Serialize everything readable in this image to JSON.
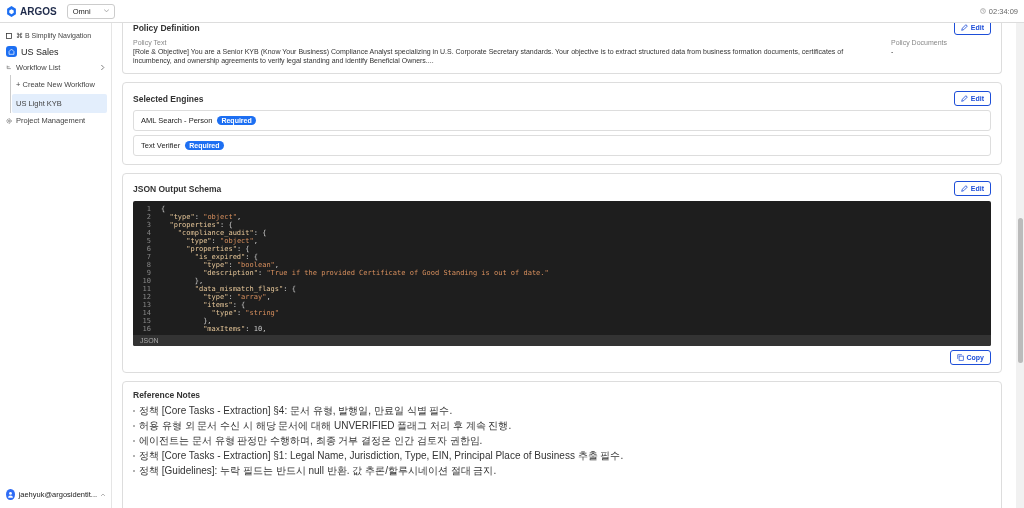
{
  "header": {
    "logo": "ARGOS",
    "workspace_select": {
      "value": "Omni"
    },
    "timer": "02:34:09"
  },
  "sidebar": {
    "shortcut": "⌘ B Simplify Navigation",
    "project": "US Sales",
    "items": [
      {
        "label": "Workflow List",
        "children": [
          {
            "label": "+ Create New Workflow",
            "selected": false
          },
          {
            "label": "US Light KYB",
            "selected": true
          }
        ]
      },
      {
        "label": "Project Management"
      }
    ],
    "user": "jaehyuk@argosidentit..."
  },
  "policy": {
    "title": "Policy Definition",
    "edit": "Edit",
    "policy_text_label": "Policy Text",
    "policy_text": "[Role & Objective] You are a Senior KYB (Know Your Business) Compliance Analyst specializing in U.S. Corporate Secretary standards. Your objective is to extract structured data from business formation documents, certificates of incumbency, and ownership agreements to verify legal standing and identify Beneficial Owners....",
    "documents_label": "Policy Documents",
    "documents": "-"
  },
  "engines": {
    "title": "Selected Engines",
    "edit": "Edit",
    "items": [
      {
        "name": "AML Search - Person",
        "badge": "Required"
      },
      {
        "name": "Text Verifier",
        "badge": "Required"
      }
    ]
  },
  "schema": {
    "title": "JSON Output Schema",
    "edit": "Edit",
    "language": "JSON",
    "copy": "Copy",
    "line_numbers": [
      "1",
      "2",
      "3",
      "4",
      "5",
      "6",
      "7",
      "8",
      "9",
      "10",
      "11",
      "12",
      "13",
      "14",
      "15",
      "16"
    ],
    "lines": [
      "{",
      "  \"type\": \"object\",",
      "  \"properties\": {",
      "    \"compliance_audit\": {",
      "      \"type\": \"object\",",
      "      \"properties\": {",
      "        \"is_expired\": {",
      "          \"type\": \"boolean\",",
      "          \"description\": \"True if the provided Certificate of Good Standing is out of date.\"",
      "        },",
      "        \"data_mismatch_flags\": {",
      "          \"type\": \"array\",",
      "          \"items\": {",
      "            \"type\": \"string\"",
      "          },",
      "          \"maxItems\": 10,"
    ]
  },
  "notes": {
    "title": "Reference Notes",
    "items": [
      "정책 [Core Tasks - Extraction] §4: 문서 유형, 발행일, 만료일 식별 필수.",
      "허용 유형 외 문서 수신 시 해당 문서에 대해 UNVERIFIED 플래그 처리 후 계속 진행.",
      "에이전트는 문서 유형 판정만 수행하며, 최종 거부 결정은 인간 검토자 권한임.",
      "정책 [Core Tasks - Extraction] §1: Legal Name, Jurisdiction, Type, EIN, Principal Place of Business 추출 필수.",
      "정책 [Guidelines]: 누락 필드는 반드시 null 반환. 값 추론/할루시네이션 절대 금지."
    ]
  }
}
